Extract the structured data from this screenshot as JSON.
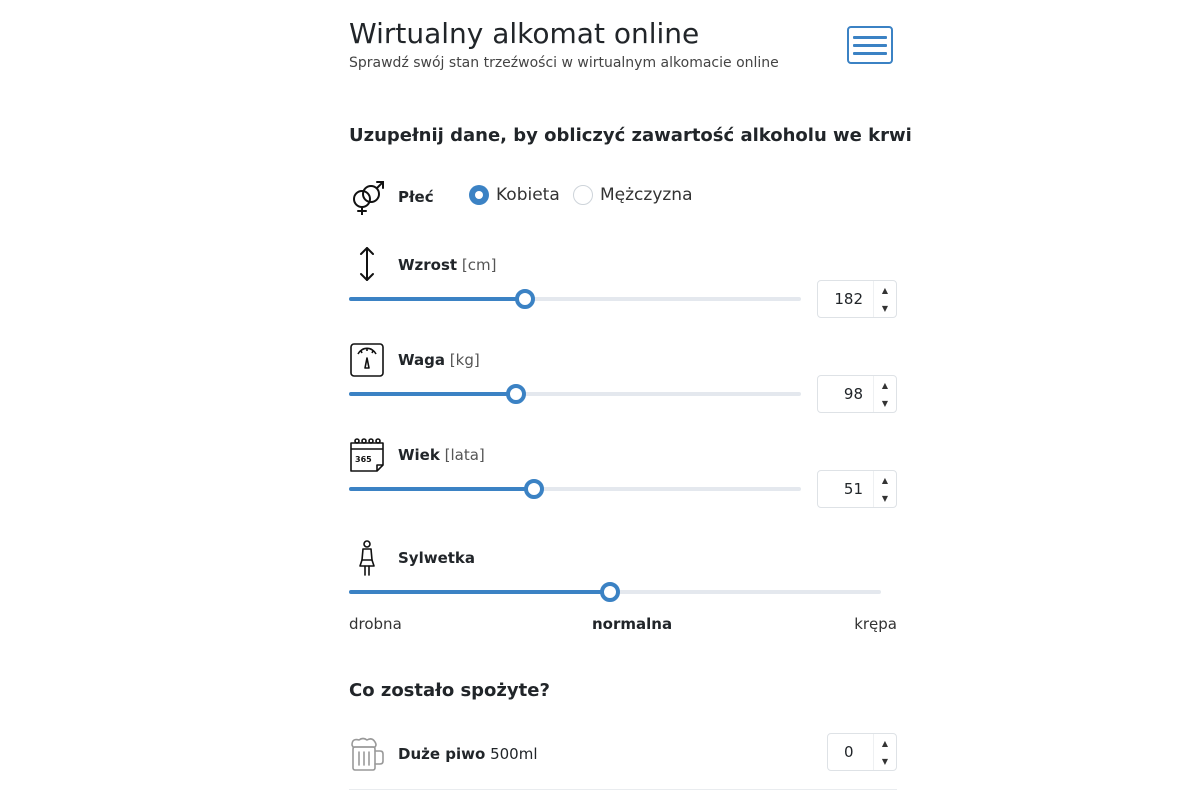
{
  "header": {
    "title": "Wirtualny alkomat online",
    "subtitle": "Sprawdź swój stan trzeźwości w wirtualnym alkomacie online",
    "menu_icon": "hamburger-menu-icon"
  },
  "form": {
    "heading": "Uzupełnij dane, by obliczyć zawartość alkoholu we krwi",
    "gender": {
      "icon": "gender-symbols-icon",
      "label": "Płeć",
      "options": [
        {
          "label": "Kobieta",
          "selected": true
        },
        {
          "label": "Mężczyzna",
          "selected": false
        }
      ]
    },
    "height": {
      "icon": "vertical-arrows-icon",
      "label": "Wzrost",
      "unit": "[cm]",
      "value": "182",
      "slider_fraction": 0.39
    },
    "weight": {
      "icon": "scale-icon",
      "label": "Waga",
      "unit": "[kg]",
      "value": "98",
      "slider_fraction": 0.37
    },
    "age": {
      "icon": "calendar-365-icon",
      "label": "Wiek",
      "unit": "[lata]",
      "value": "51",
      "slider_fraction": 0.41
    },
    "build": {
      "icon": "person-silhouette-icon",
      "label": "Sylwetka",
      "slider_fraction": 0.49,
      "scale": [
        "drobna",
        "normalna",
        "krępa"
      ],
      "selected_index": 1
    }
  },
  "consumption": {
    "heading": "Co zostało spożyte?",
    "items": [
      {
        "icon": "beer-mug-icon",
        "name": "Duże piwo",
        "volume": "500ml",
        "value": "0"
      }
    ]
  },
  "colors": {
    "accent": "#3b82c4",
    "track": "#e4e8ee",
    "text": "#212529"
  }
}
